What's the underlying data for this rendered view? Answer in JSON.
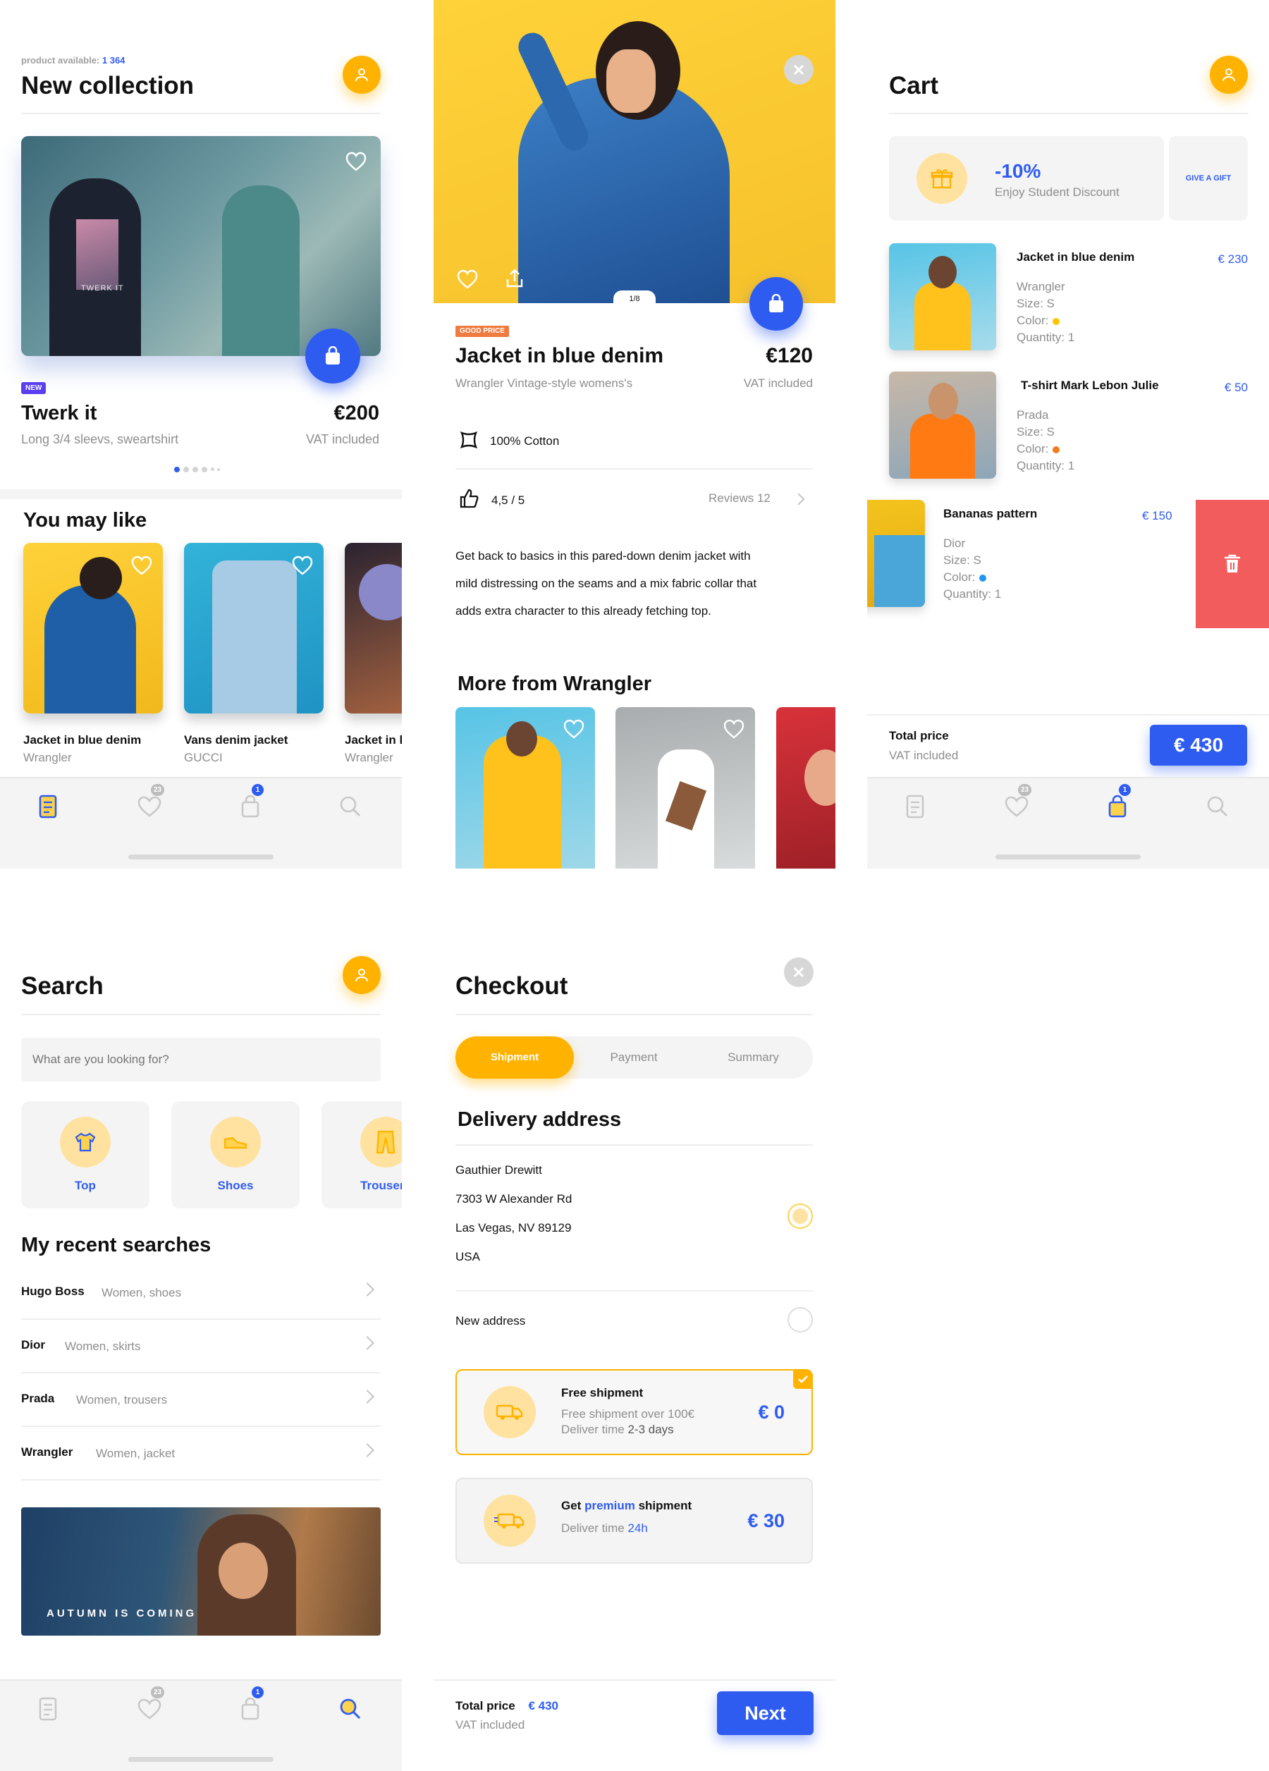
{
  "colors": {
    "accent_blue": "#2f5cf0",
    "accent_yellow": "#ffb300",
    "delete_red": "#f25c5c",
    "badge_orange": "#f07b3f"
  },
  "tabbar": {
    "fav_count": "23",
    "cart_count": "1",
    "icons": [
      "catalog-icon",
      "heart-icon",
      "bag-icon",
      "search-icon"
    ]
  },
  "collection": {
    "available_label": "product available:",
    "available_count": "1 364",
    "title": "New collection",
    "hero": {
      "badge": "NEW",
      "name": "Twerk it",
      "desc": "Long 3/4 sleevs, sweartshirt",
      "price": "€200",
      "vat": "VAT included",
      "image_text": "TWERK IT"
    },
    "like_title": "You may like",
    "likes": [
      {
        "name": "Jacket in blue denim",
        "brand": "Wrangler"
      },
      {
        "name": "Vans denim jacket",
        "brand": "GUCCI"
      },
      {
        "name": "Jacket in l",
        "brand": "Wrangler"
      }
    ]
  },
  "product": {
    "image_counter": "1/8",
    "badge": "GOOD PRICE",
    "name": "Jacket in blue denim",
    "price": "€120",
    "subtitle": "Wrangler Vintage-style womens's",
    "vat": "VAT included",
    "material": "100% Cotton",
    "rating": "4,5 / 5",
    "reviews": "Reviews 12",
    "description": [
      "Get back to basics in this pared-down denim jacket with",
      "mild distressing on the seams and a mix fabric collar that",
      "adds extra character to this already fetching top."
    ],
    "more_title": "More from Wrangler"
  },
  "cart": {
    "title": "Cart",
    "discount": {
      "percent": "-10%",
      "label": "Enjoy Student Discount",
      "gift": "GIVE A GIFT"
    },
    "items": [
      {
        "name": "Jacket in blue denim",
        "price": "€ 230",
        "brand": "Wrangler",
        "size": "Size: S",
        "color_label": "Color:",
        "color": "#ffc400",
        "qty": "Quantity: 1"
      },
      {
        "name": "T-shirt Mark Lebon Julie",
        "price": "€ 50",
        "brand": "Prada",
        "size": "Size: S",
        "color_label": "Color:",
        "color": "#f07b20",
        "qty": "Quantity: 1"
      },
      {
        "name": "Bananas pattern",
        "price": "€ 150",
        "brand": "Dior",
        "size": "Size: S",
        "color_label": "Color:",
        "color": "#2196f3",
        "qty": "Quantity: 1"
      }
    ],
    "total_label": "Total price",
    "vat": "VAT included",
    "total": "€ 430"
  },
  "search": {
    "title": "Search",
    "placeholder": "What are you looking for?",
    "categories": [
      "Top",
      "Shoes",
      "Trousers"
    ],
    "recent_title": "My recent searches",
    "recent": [
      {
        "brand": "Hugo Boss",
        "query": "Women, shoes"
      },
      {
        "brand": "Dior",
        "query": "Women, skirts"
      },
      {
        "brand": "Prada",
        "query": "Women, trousers"
      },
      {
        "brand": "Wrangler",
        "query": "Women, jacket"
      }
    ],
    "banner": "AUTUMN IS COMING"
  },
  "checkout": {
    "title": "Checkout",
    "steps": [
      "Shipment",
      "Payment",
      "Summary"
    ],
    "delivery_title": "Delivery address",
    "address": [
      "Gauthier Drewitt",
      "7303 W Alexander Rd",
      "Las Vegas, NV 89129",
      "USA"
    ],
    "new_address": "New address",
    "free": {
      "title": "Free shipment",
      "line1": "Free shipment over 100€",
      "line2_prefix": "Deliver time ",
      "line2_value": "2-3 days",
      "price": "€ 0"
    },
    "premium": {
      "title_prefix": "Get ",
      "title_accent": "premium",
      "title_suffix": " shipment",
      "line_prefix": "Deliver time ",
      "line_value": "24h",
      "price": "€ 30"
    },
    "total_label": "Total price",
    "total": "€ 430",
    "vat": "VAT included",
    "next": "Next"
  }
}
